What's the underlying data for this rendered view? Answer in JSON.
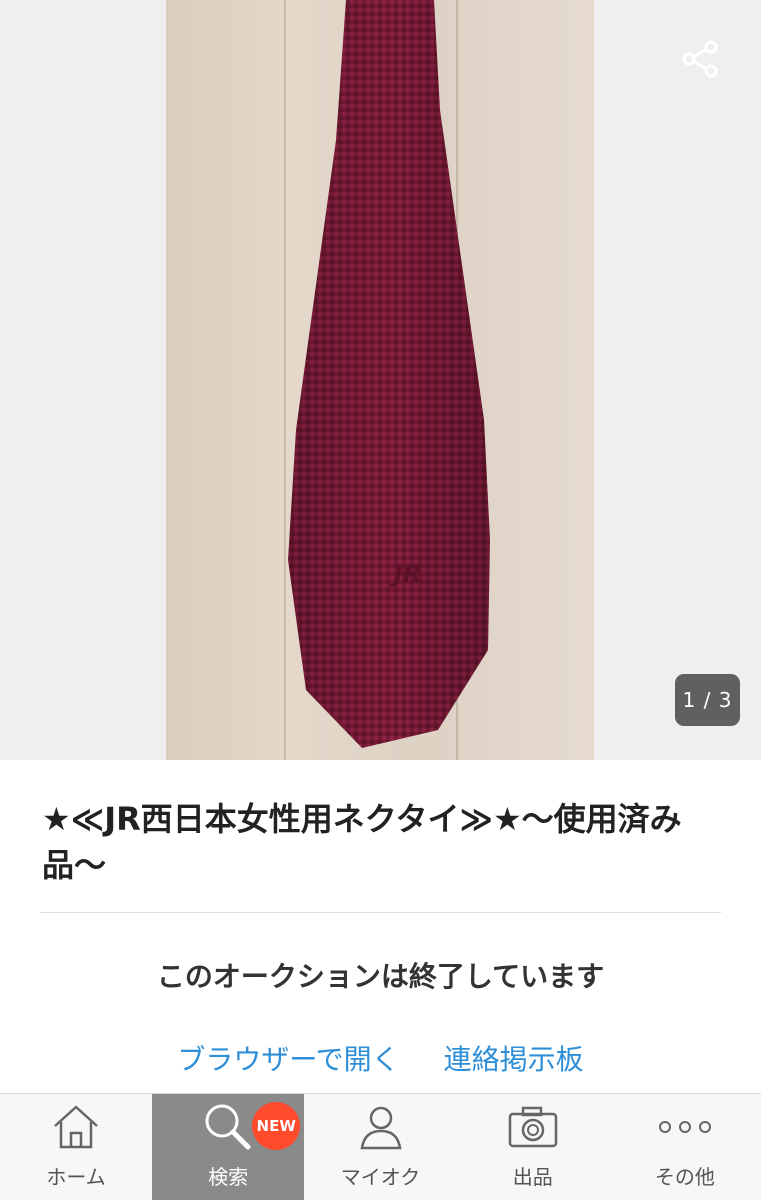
{
  "gallery": {
    "counter": "1 / 3",
    "share_icon": "share-icon",
    "tie_logo": "JR"
  },
  "item": {
    "title": "★≪JR西日本女性用ネクタイ≫★〜使用済み品〜"
  },
  "status": {
    "ended_text": "このオークションは終了しています"
  },
  "links": {
    "browser": "ブラウザーで開く",
    "board": "連絡掲示板"
  },
  "tabbar": {
    "tabs": [
      {
        "label": "ホーム",
        "icon": "home-icon"
      },
      {
        "label": "検索",
        "icon": "search-icon",
        "badge": "NEW",
        "active": true
      },
      {
        "label": "マイオク",
        "icon": "user-icon"
      },
      {
        "label": "出品",
        "icon": "camera-icon"
      },
      {
        "label": "その他",
        "icon": "more-icon"
      }
    ]
  },
  "colors": {
    "link": "#2e8fd8",
    "badge": "#ff4b2b",
    "active_tab": "#8a8a8a",
    "tie": "#7a1a35"
  }
}
